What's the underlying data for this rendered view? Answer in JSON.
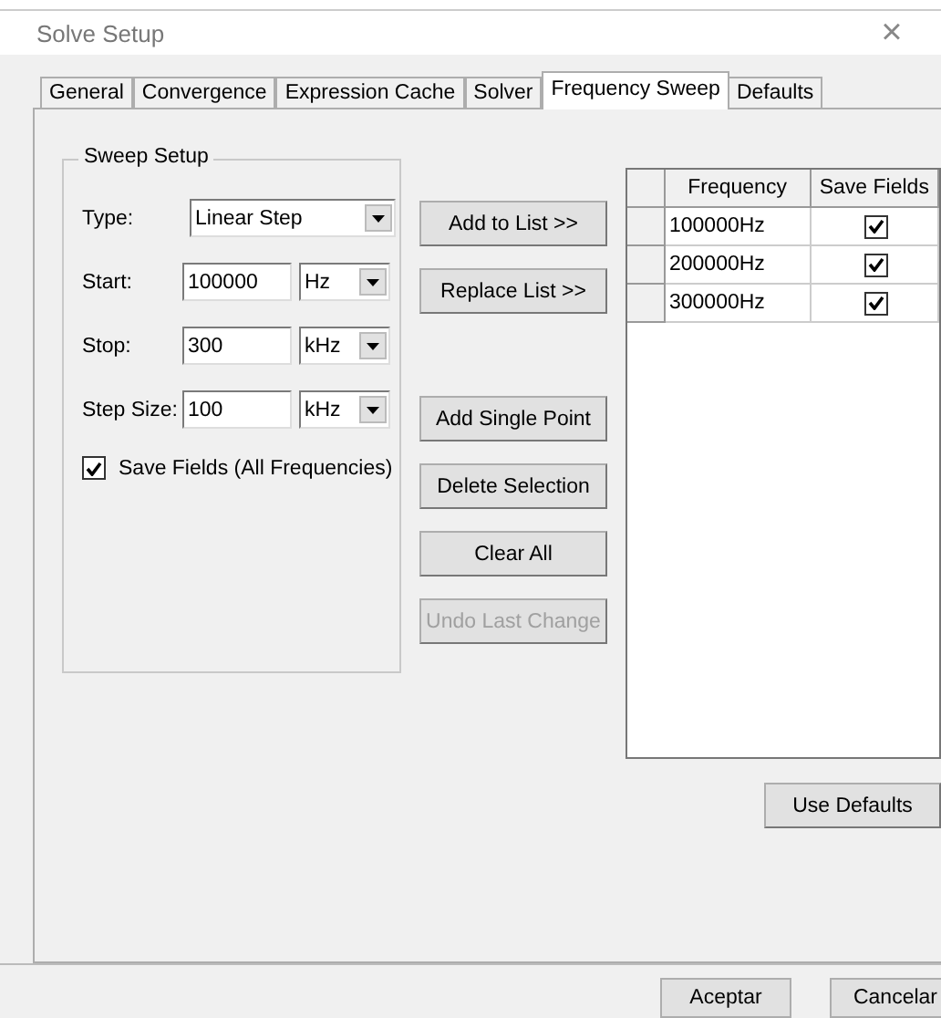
{
  "window": {
    "title": "Solve Setup",
    "close": "×"
  },
  "tabs": [
    {
      "label": "General",
      "selected": false
    },
    {
      "label": "Convergence",
      "selected": false
    },
    {
      "label": "Expression Cache",
      "selected": false
    },
    {
      "label": "Solver",
      "selected": false
    },
    {
      "label": "Frequency Sweep",
      "selected": true
    },
    {
      "label": "Defaults",
      "selected": false
    }
  ],
  "sweep_setup": {
    "title": "Sweep Setup",
    "fields": [
      {
        "label": "Type:",
        "kind": "select",
        "value": "Linear Step"
      },
      {
        "label": "Start:",
        "kind": "unit",
        "value": "100000",
        "unit": "Hz"
      },
      {
        "label": "Stop:",
        "kind": "unit",
        "value": "300",
        "unit": "kHz"
      },
      {
        "label": "Step Size:",
        "kind": "unit",
        "value": "100",
        "unit": "kHz"
      }
    ],
    "save_fields": {
      "label": "Save Fields (All Frequencies)",
      "checked": true
    }
  },
  "list_buttons": [
    {
      "label": "Add to List >>",
      "disabled": false
    },
    {
      "label": "Replace List >>",
      "disabled": false
    }
  ],
  "point_buttons": [
    {
      "label": "Add Single Point",
      "disabled": false
    },
    {
      "label": "Delete Selection",
      "disabled": false
    },
    {
      "label": "Clear All",
      "disabled": false
    },
    {
      "label": "Undo Last Change",
      "disabled": true
    }
  ],
  "table": {
    "columns": [
      "Frequency",
      "Save Fields"
    ],
    "rows": [
      {
        "frequency": "100000Hz",
        "save_fields": true
      },
      {
        "frequency": "200000Hz",
        "save_fields": true
      },
      {
        "frequency": "300000Hz",
        "save_fields": true
      }
    ]
  },
  "use_defaults": "Use Defaults",
  "dialog_buttons": [
    "Aceptar",
    "Cancelar"
  ]
}
